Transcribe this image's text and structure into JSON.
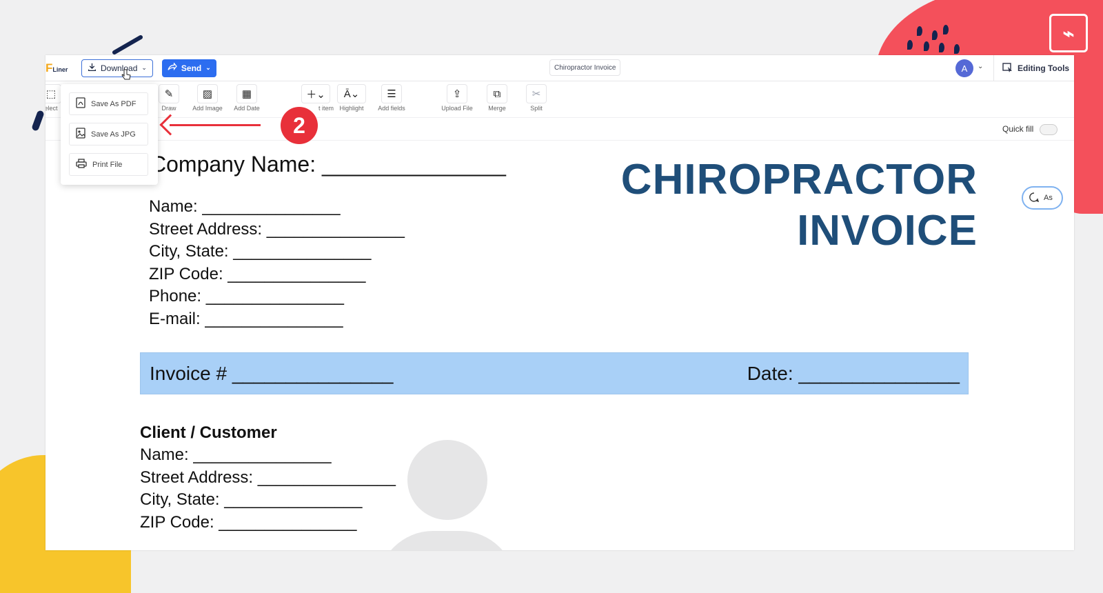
{
  "app": {
    "logo_text": "F",
    "logo_sub": "Liner",
    "download_label": "Download",
    "send_label": "Send",
    "document_title": "Chiropractor Invoice",
    "avatar_initial": "A",
    "editing_tools_label": "Editing Tools",
    "quick_fill_label": "Quick fill",
    "ask_label": "As"
  },
  "toolbar": {
    "tools": [
      {
        "label": "elect",
        "icon": "select-icon"
      },
      {
        "label": "Draw",
        "icon": "pen-icon"
      },
      {
        "label": "Add Image",
        "icon": "image-icon"
      },
      {
        "label": "Add Date",
        "icon": "calendar-icon"
      },
      {
        "label": "t item",
        "icon": "plus-icon"
      },
      {
        "label": "Highlight",
        "icon": "highlight-icon"
      },
      {
        "label": "Add fields",
        "icon": "fields-icon"
      },
      {
        "label": "Upload File",
        "icon": "upload-icon"
      },
      {
        "label": "Merge",
        "icon": "merge-icon"
      },
      {
        "label": "Split",
        "icon": "split-icon"
      }
    ]
  },
  "download_menu": {
    "items": [
      {
        "label": "Save As PDF",
        "icon": "pdf-file-icon"
      },
      {
        "label": "Save As JPG",
        "icon": "image-file-icon"
      },
      {
        "label": "Print File",
        "icon": "printer-icon"
      }
    ]
  },
  "annotation": {
    "step_number": "2",
    "arrow_color": "#e8303a"
  },
  "document": {
    "company_line": "Company Name: _______________",
    "title_line1": "CHIROPRACTOR",
    "title_line2": "INVOICE",
    "title_color": "#1f4e79",
    "sender_lines": [
      "Name: _______________",
      "Street Address: _______________",
      "City, State: _______________",
      "ZIP Code: _______________",
      "Phone: _______________",
      "E-mail: _______________"
    ],
    "invoice_label": "Invoice #  _______________",
    "date_label": "Date:  _______________",
    "invoice_bar_color": "#a9d0f7",
    "client_heading": "Client / Customer",
    "client_lines": [
      "Name: _______________",
      "Street Address: _______________",
      "City, State: _______________",
      "ZIP Code: _______________"
    ]
  },
  "colors": {
    "accent_blue": "#2c6df0",
    "deco_red": "#f4505b",
    "deco_yellow": "#f7c52b",
    "deco_navy": "#14244f"
  }
}
